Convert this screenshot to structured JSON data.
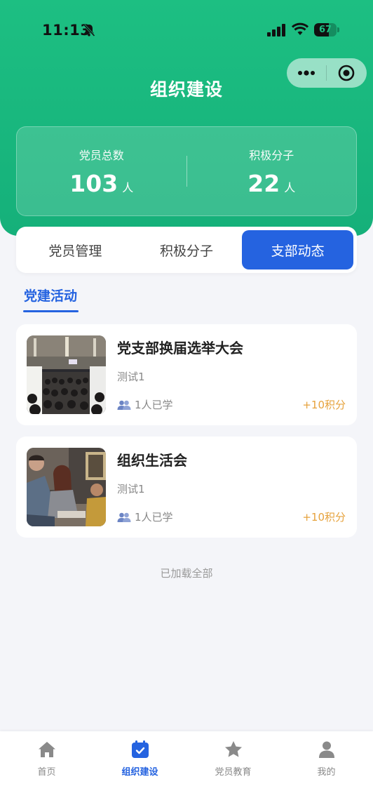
{
  "status_bar": {
    "time": "11:13",
    "battery": "67",
    "battery_level": 0.67
  },
  "page": {
    "title": "组织建设"
  },
  "stats": [
    {
      "label": "党员总数",
      "value": "103",
      "unit": "人"
    },
    {
      "label": "积极分子",
      "value": "22",
      "unit": "人"
    }
  ],
  "tabs": [
    {
      "label": "党员管理",
      "active": false
    },
    {
      "label": "积极分子",
      "active": false
    },
    {
      "label": "支部动态",
      "active": true
    }
  ],
  "section": {
    "title": "党建活动"
  },
  "activities": [
    {
      "title": "党支部换届选举大会",
      "desc": "测试1",
      "learned": "1人已学",
      "points": "+10积分"
    },
    {
      "title": "组织生活会",
      "desc": "测试1",
      "learned": "1人已学",
      "points": "+10积分"
    }
  ],
  "footer": {
    "load_all": "已加载全部"
  },
  "nav": [
    {
      "label": "首页",
      "icon": "home-icon",
      "active": false
    },
    {
      "label": "组织建设",
      "icon": "calendar-icon",
      "active": true
    },
    {
      "label": "党员教育",
      "icon": "star-icon",
      "active": false
    },
    {
      "label": "我的",
      "icon": "user-icon",
      "active": false
    }
  ],
  "colors": {
    "brand_green": "#1dbf82",
    "accent_blue": "#2563e0",
    "points_orange": "#e6a23c"
  }
}
